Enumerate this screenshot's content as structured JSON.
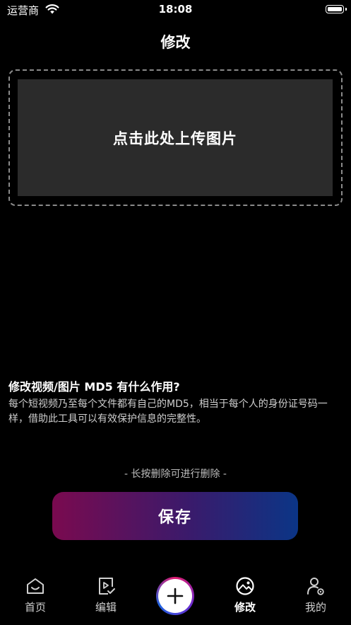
{
  "status_bar": {
    "carrier": "运营商",
    "time": "18:08"
  },
  "header": {
    "title": "修改"
  },
  "upload": {
    "label": "点击此处上传图片"
  },
  "info": {
    "title": "修改视频/图片 MD5 有什么作用?",
    "description": "每个短视频乃至每个文件都有自己的MD5，相当于每个人的身份证号码一样，借助此工具可以有效保护信息的完整性。"
  },
  "hint": "- 长按删除可进行删除 -",
  "save_button": {
    "label": "保存"
  },
  "colors": {
    "background": "#000000",
    "upload_area": "#2b2b2b",
    "gradient_start": "#7a0a4f",
    "gradient_end": "#0b3586"
  },
  "tab_bar": {
    "items": [
      {
        "label": "首页",
        "icon": "home-icon",
        "active": false
      },
      {
        "label": "编辑",
        "icon": "edit-video-icon",
        "active": false
      },
      {
        "label": "",
        "icon": "plus-icon",
        "active": false
      },
      {
        "label": "修改",
        "icon": "image-icon",
        "active": true
      },
      {
        "label": "我的",
        "icon": "profile-icon",
        "active": false
      }
    ]
  }
}
